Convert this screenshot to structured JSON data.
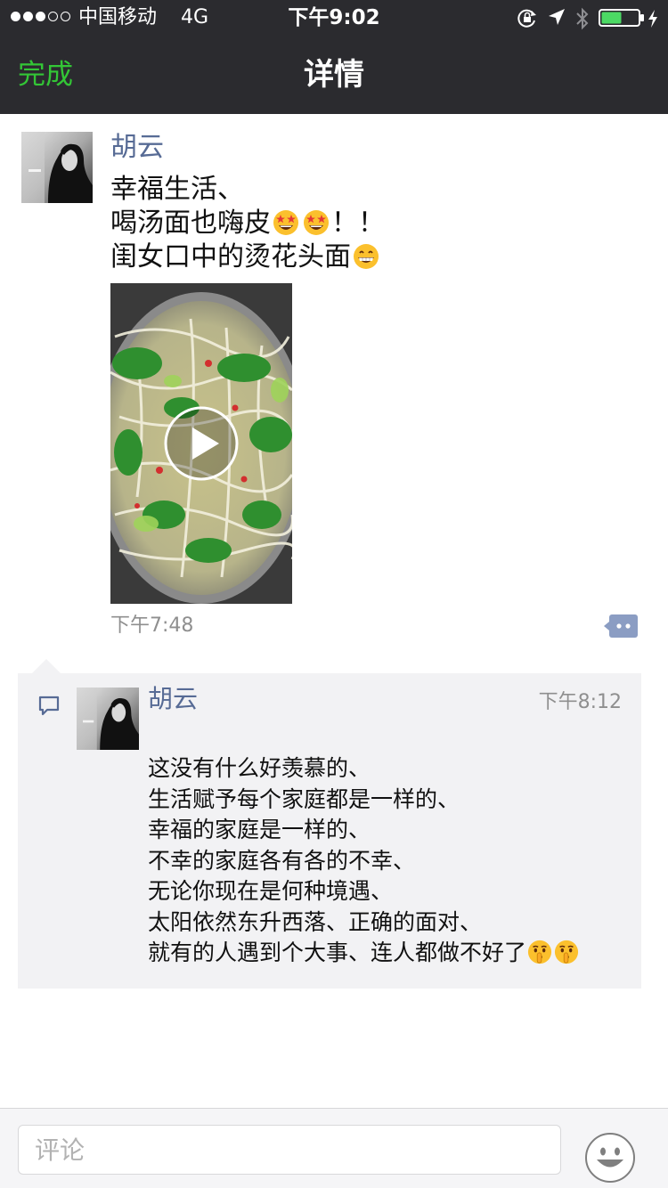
{
  "status_bar": {
    "carrier": "中国移动",
    "network": "4G",
    "time": "下午9:02",
    "signal_bars_filled": 3,
    "signal_bars_total": 5,
    "battery_level": 0.55,
    "battery_color": "#4cd964",
    "icons": [
      "orientation-lock-icon",
      "location-arrow-icon",
      "bluetooth-icon",
      "battery-icon",
      "charging-bolt-icon"
    ]
  },
  "nav": {
    "done_label": "完成",
    "title": "详情",
    "accent_color": "#33c636",
    "bar_color": "#2b2b2f"
  },
  "post": {
    "author": "胡云",
    "line1": "幸福生活、",
    "line2_prefix": "喝汤面也嗨皮",
    "line2_suffix": "！！",
    "line3_prefix": "闺女口中的烫花头面",
    "emojis": [
      "star-struck-emoji-icon",
      "star-struck-emoji-icon",
      "grinning-emoji-icon"
    ],
    "media": "video-thumbnail",
    "time": "下午7:48",
    "name_color": "#576b95"
  },
  "comment": {
    "author": "胡云",
    "time": "下午8:12",
    "lines": [
      "这没有什么好羡慕的、",
      "生活赋予每个家庭都是一样的、",
      "幸福的家庭是一样的、",
      "不幸的家庭各有各的不幸、",
      "无论你现在是何种境遇、",
      "太阳依然东升西落、正确的面对、",
      "就有的人遇到个大事、连人都做不好了"
    ],
    "trailing_emojis": [
      "shushing-face-emoji-icon",
      "shushing-face-emoji-icon"
    ],
    "background": "#f2f2f4"
  },
  "input_bar": {
    "placeholder": "评论",
    "value": ""
  }
}
